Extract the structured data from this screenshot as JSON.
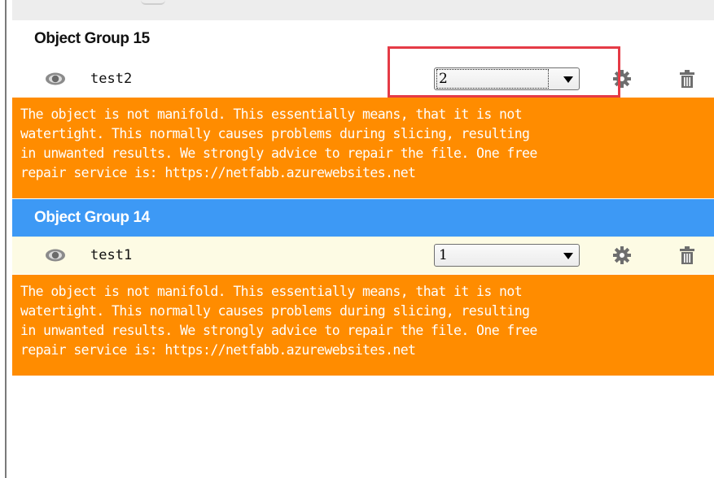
{
  "groups": [
    {
      "title": "Object Group 15",
      "object": {
        "name": "test2",
        "selected_value": "2",
        "icons": [
          "eye-icon",
          "gear-icon",
          "trash-icon"
        ]
      },
      "warning_lines": [
        "The object is not manifold. This essentially means, that it is not",
        "watertight. This normally causes problems during slicing, resulting",
        "in unwanted results. We strongly advice to repair the file. One free",
        "repair service is: https://netfabb.azurewebsites.net"
      ]
    },
    {
      "title": "Object Group 14",
      "object": {
        "name": "test1",
        "selected_value": "1",
        "icons": [
          "eye-icon",
          "gear-icon",
          "trash-icon"
        ]
      },
      "warning_lines": [
        "The object is not manifold. This essentially means, that it is not",
        "watertight. This normally causes problems during slicing, resulting",
        "in unwanted results. We strongly advice to repair the file. One free",
        "repair service is: https://netfabb.azurewebsites.net"
      ]
    }
  ],
  "colors": {
    "warning_background": "#ff8c00",
    "selected_header": "#3d99f5",
    "selected_row": "#fdfbe4",
    "annotation_box": "#e53b46"
  }
}
